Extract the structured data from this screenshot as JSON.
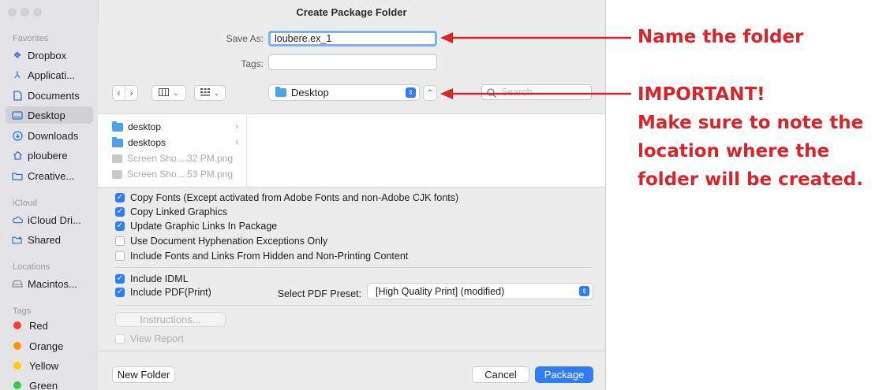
{
  "window": {
    "title": "Create Package Folder"
  },
  "sidebar": {
    "sections": [
      {
        "heading": "Favorites",
        "items": [
          {
            "label": "Dropbox",
            "icon": "dropbox-icon"
          },
          {
            "label": "Applicati...",
            "icon": "applications-icon"
          },
          {
            "label": "Documents",
            "icon": "document-icon"
          },
          {
            "label": "Desktop",
            "icon": "desktop-icon",
            "selected": true
          },
          {
            "label": "Downloads",
            "icon": "download-icon"
          },
          {
            "label": "ploubere",
            "icon": "home-icon"
          },
          {
            "label": "Creative...",
            "icon": "folder-icon"
          }
        ]
      },
      {
        "heading": "iCloud",
        "items": [
          {
            "label": "iCloud Dri...",
            "icon": "cloud-icon"
          },
          {
            "label": "Shared",
            "icon": "shared-folder-icon"
          }
        ]
      },
      {
        "heading": "Locations",
        "items": [
          {
            "label": "Macintos...",
            "icon": "drive-icon"
          }
        ]
      },
      {
        "heading": "Tags",
        "items": [
          {
            "label": "Red",
            "color": "#ff3b30"
          },
          {
            "label": "Orange",
            "color": "#ff9500"
          },
          {
            "label": "Yellow",
            "color": "#ffcc00"
          },
          {
            "label": "Green",
            "color": "#34c759"
          }
        ]
      }
    ]
  },
  "form": {
    "save_as_label": "Save As:",
    "save_as_value": "loubere.ex_1",
    "tags_label": "Tags:",
    "location": "Desktop",
    "search_placeholder": "Search"
  },
  "files": [
    {
      "name": "desktop",
      "type": "folder"
    },
    {
      "name": "desktops",
      "type": "folder"
    },
    {
      "name": "Screen Sho....32 PM.png",
      "type": "image"
    },
    {
      "name": "Screen Sho....53 PM.png",
      "type": "image"
    }
  ],
  "options": {
    "copy_fonts": {
      "label": "Copy Fonts (Except activated from Adobe Fonts and non-Adobe CJK fonts)",
      "checked": true
    },
    "copy_linked": {
      "label": "Copy Linked Graphics",
      "checked": true
    },
    "update_links": {
      "label": "Update Graphic Links In Package",
      "checked": true
    },
    "hyphenation": {
      "label": "Use Document Hyphenation Exceptions Only",
      "checked": false
    },
    "hidden_content": {
      "label": "Include Fonts and Links From Hidden and Non-Printing Content",
      "checked": false
    },
    "include_idml": {
      "label": "Include IDML",
      "checked": true
    },
    "include_pdf": {
      "label": "Include PDF(Print)",
      "checked": true
    },
    "pdf_preset_label": "Select PDF Preset:",
    "pdf_preset_value": "[High Quality Print] (modified)",
    "instructions_label": "Instructions...",
    "view_report": {
      "label": "View Report",
      "checked": false
    }
  },
  "buttons": {
    "new_folder": "New Folder",
    "cancel": "Cancel",
    "package": "Package"
  },
  "annotations": {
    "name_note": "Name the folder",
    "location_note": [
      "IMPORTANT!",
      "Make sure to note the",
      "location where the",
      "folder will be created."
    ],
    "color": "#d4262b"
  },
  "colors": {
    "accent": "#2f7cf6"
  }
}
